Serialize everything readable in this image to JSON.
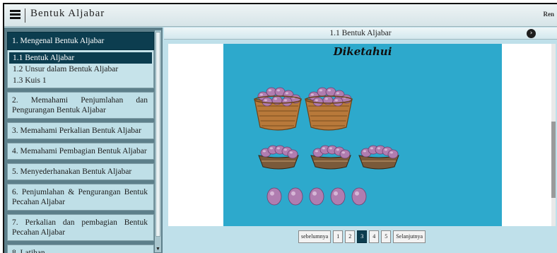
{
  "app": {
    "title": "Bentuk Aljabar",
    "topbar_right": "Ren"
  },
  "sidebar": {
    "sections": [
      {
        "label": "1. Mengenal Bentuk Aljabar",
        "active": true,
        "items": [
          {
            "label": "1.1 Bentuk Aljabar",
            "active": true
          },
          {
            "label": "1.2 Unsur dalam Bentuk Aljabar",
            "active": false
          },
          {
            "label": "1.3 Kuis 1",
            "active": false
          }
        ]
      },
      {
        "label": "2. Memahami Penjumlahan dan Pengurangan Bentuk Aljabar"
      },
      {
        "label": "3. Memahami Perkalian Bentuk Aljabar"
      },
      {
        "label": "4. Memahami Pembagian Bentuk Aljabar"
      },
      {
        "label": "5. Menyederhanakan Bentuk Aljabar"
      },
      {
        "label": "6. Penjumlahan & Pengurangan Bentuk Pecahan Aljabar"
      },
      {
        "label": "7. Perkalian dan pembagian Bentuk Pecahan Aljabar"
      },
      {
        "label": "8. Latihan"
      }
    ]
  },
  "main": {
    "title": "1.1 Bentuk Aljabar",
    "slide": {
      "heading": "Diketahui",
      "big_baskets": 2,
      "small_baskets": 3,
      "loose_eggs": 5
    },
    "pager": {
      "prev_label": "sebelumnya",
      "pages": [
        "1",
        "2",
        "3",
        "4",
        "5"
      ],
      "current_page": "3",
      "next_label": "Selanjutnya"
    }
  },
  "colors": {
    "accent": "#0c3d4f",
    "slide_background": "#2da9cc",
    "sidebar_background": "#5d7f8a",
    "egg": "#b07db0"
  }
}
